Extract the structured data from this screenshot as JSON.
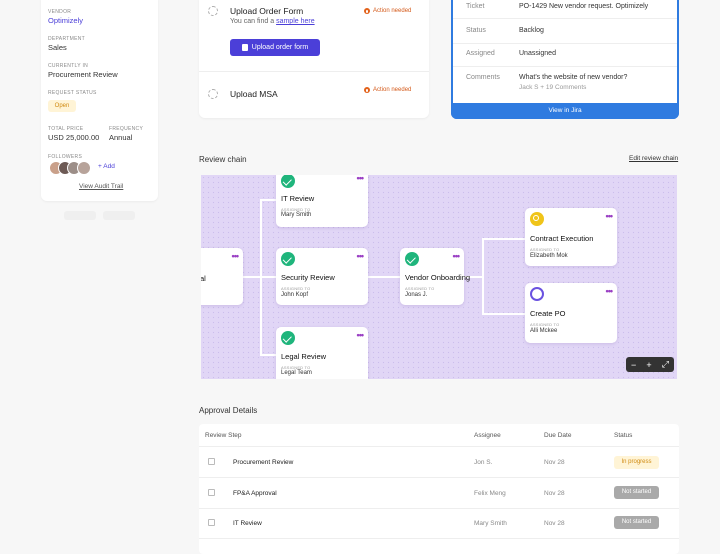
{
  "sidebar": {
    "vendor_label": "VENDOR",
    "vendor": "Optimizely",
    "department_label": "DEPARTMENT",
    "department": "Sales",
    "currently_in_label": "CURRENTLY IN",
    "currently_in": "Procurement Review",
    "request_status_label": "REQUEST STATUS",
    "request_status": "Open",
    "total_price_label": "TOTAL PRICE",
    "total_price": "USD 25,000.00",
    "frequency_label": "FREQUENCY",
    "frequency": "Annual",
    "followers_label": "FOLLOWERS",
    "add_label": "+ Add",
    "audit_link": "View Audit Trail"
  },
  "tasks": {
    "order_form_title": "Upload Order Form",
    "order_form_sub": "You can find a",
    "order_form_link": "sample here",
    "upload_button": "Upload order form",
    "msa_title": "Upload MSA",
    "action_label": "Action needed"
  },
  "jira": {
    "rows": [
      {
        "key": "Ticket",
        "value": "PO-1429 New vendor request. Optimizely"
      },
      {
        "key": "Status",
        "value": "Backlog"
      },
      {
        "key": "Assigned",
        "value": "Unassigned"
      },
      {
        "key": "Comments",
        "value": "What's the website of new vendor?",
        "sub": "Jack S + 19 Comments"
      }
    ],
    "button": "View in Jira"
  },
  "review_chain": {
    "title": "Review chain",
    "edit_link": "Edit review chain",
    "assigned_label": "ASSIGNED TO",
    "menu_glyph": "•••",
    "nodes": {
      "left_partial": {
        "title": "al"
      },
      "it_review": {
        "title": "IT Review",
        "assignee": "Mary Smith"
      },
      "security_review": {
        "title": "Security Review",
        "assignee": "John Kopf"
      },
      "legal_review": {
        "title": "Legal Review",
        "assignee": "Legal Team"
      },
      "vendor_onboarding": {
        "title": "Vendor Onboarding",
        "assignee": "Jonas J."
      },
      "contract_execution": {
        "title": "Contract Execution",
        "assignee": "Elizabeth Mok"
      },
      "create_po": {
        "title": "Create PO",
        "assignee": "Alli Mckee"
      }
    },
    "zoom": {
      "minus": "−",
      "plus": "+",
      "fit": "⤢"
    }
  },
  "approval": {
    "title": "Approval Details",
    "headers": {
      "step": "Review Step",
      "assignee": "Assignee",
      "due": "Due Date",
      "status": "Status"
    },
    "rows": [
      {
        "step": "Procurement Review",
        "assignee": "Jon S.",
        "due": "Nov 28",
        "status": "In progress"
      },
      {
        "step": "FP&A Approval",
        "assignee": "Felix Meng",
        "due": "Nov 28",
        "status": "Not started"
      },
      {
        "step": "IT Review",
        "assignee": "Mary Smith",
        "due": "Nov 28",
        "status": "Not started"
      }
    ]
  },
  "colors": {
    "accent": "#4b3fd8",
    "jira": "#2f7be0",
    "canvas": "#e1d6f6",
    "success": "#1fb57c",
    "warning": "#e2611a"
  }
}
